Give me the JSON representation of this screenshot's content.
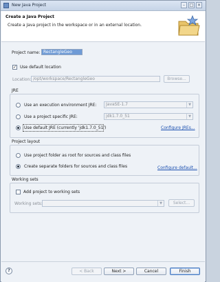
{
  "window": {
    "title": "New Java Project",
    "minimize": "–",
    "maximize": "□",
    "close": "×"
  },
  "header": {
    "title": "Create a Java Project",
    "subtitle": "Create a Java project in the workspace or in an external location."
  },
  "project": {
    "name_label": "Project name:",
    "name_value": "RectangleGeo",
    "use_default_location_label": "Use default location",
    "use_default_location_checked": true,
    "location_label": "Location:",
    "location_value": "/opt/workspace/RectangleGeo",
    "browse_label": "Browse..."
  },
  "jre": {
    "group_title": "JRE",
    "options": [
      {
        "label": "Use an execution environment JRE:",
        "value": "JavaSE-1.7",
        "selected": false
      },
      {
        "label": "Use a project specific JRE:",
        "value": "jdk1.7.0_51",
        "selected": false
      },
      {
        "label": "Use default JRE (currently 'jdk1.7.0_51')",
        "selected": true
      }
    ],
    "configure_link": "Configure JREs..."
  },
  "layout": {
    "group_title": "Project layout",
    "options": [
      {
        "label": "Use project folder as root for sources and class files",
        "selected": false
      },
      {
        "label": "Create separate folders for sources and class files",
        "selected": true
      }
    ],
    "configure_link": "Configure default..."
  },
  "working_sets": {
    "group_title": "Working sets",
    "add_label": "Add project to working sets",
    "add_checked": false,
    "sets_label": "Working sets:",
    "select_label": "Select..."
  },
  "footer": {
    "help": "?",
    "back": "< Back",
    "next": "Next >",
    "cancel": "Cancel",
    "finish": "Finish"
  },
  "colors": {
    "accent": "#1a4fb0",
    "window_bg": "#eef2f7",
    "header_bg": "#ffffff"
  }
}
